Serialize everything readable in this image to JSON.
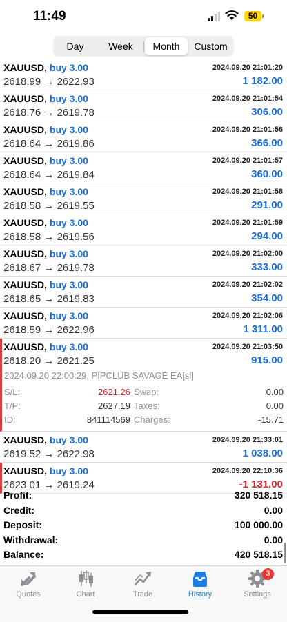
{
  "status_bar": {
    "time": "11:49",
    "battery": "50"
  },
  "period_tabs": [
    {
      "label": "Day",
      "active": false
    },
    {
      "label": "Week",
      "active": false
    },
    {
      "label": "Month",
      "active": true
    },
    {
      "label": "Custom",
      "active": false
    }
  ],
  "deals": [
    {
      "symbol": "XAUUSD,",
      "type": "buy 3.00",
      "time": "2024.09.20 21:01:20",
      "open_price": "2618.99",
      "arrow": "→",
      "close_price": "2622.93",
      "profit": "1 182.00"
    },
    {
      "symbol": "XAUUSD,",
      "type": "buy 3.00",
      "time": "2024.09.20 21:01:54",
      "open_price": "2618.76",
      "arrow": "→",
      "close_price": "2619.78",
      "profit": "306.00"
    },
    {
      "symbol": "XAUUSD,",
      "type": "buy 3.00",
      "time": "2024.09.20 21:01:56",
      "open_price": "2618.64",
      "arrow": "→",
      "close_price": "2619.86",
      "profit": "366.00"
    },
    {
      "symbol": "XAUUSD,",
      "type": "buy 3.00",
      "time": "2024.09.20 21:01:57",
      "open_price": "2618.64",
      "arrow": "→",
      "close_price": "2619.84",
      "profit": "360.00"
    },
    {
      "symbol": "XAUUSD,",
      "type": "buy 3.00",
      "time": "2024.09.20 21:01:58",
      "open_price": "2618.58",
      "arrow": "→",
      "close_price": "2619.55",
      "profit": "291.00"
    },
    {
      "symbol": "XAUUSD,",
      "type": "buy 3.00",
      "time": "2024.09.20 21:01:59",
      "open_price": "2618.58",
      "arrow": "→",
      "close_price": "2619.56",
      "profit": "294.00"
    },
    {
      "symbol": "XAUUSD,",
      "type": "buy 3.00",
      "time": "2024.09.20 21:02:00",
      "open_price": "2618.67",
      "arrow": "→",
      "close_price": "2619.78",
      "profit": "333.00"
    },
    {
      "symbol": "XAUUSD,",
      "type": "buy 3.00",
      "time": "2024.09.20 21:02:02",
      "open_price": "2618.65",
      "arrow": "→",
      "close_price": "2619.83",
      "profit": "354.00"
    },
    {
      "symbol": "XAUUSD,",
      "type": "buy 3.00",
      "time": "2024.09.20 21:02:06",
      "open_price": "2618.59",
      "arrow": "→",
      "close_price": "2622.96",
      "profit": "1 311.00"
    },
    {
      "symbol": "XAUUSD,",
      "type": "buy 3.00",
      "time": "2024.09.20 21:03:50",
      "open_price": "2618.20",
      "arrow": "→",
      "close_price": "2621.25",
      "profit": "915.00"
    },
    {
      "symbol": "XAUUSD,",
      "type": "buy 3.00",
      "time": "2024.09.20 21:33:01",
      "open_price": "2619.52",
      "arrow": "→",
      "close_price": "2622.98",
      "profit": "1 038.00"
    },
    {
      "symbol": "XAUUSD,",
      "type": "buy 3.00",
      "time": "2024.09.20 22:10:36",
      "open_price": "2623.01",
      "arrow": "→",
      "close_price": "2619.24",
      "profit": "-1 131.00"
    }
  ],
  "expanded_details": {
    "comment": "2024.09.20 22:00:29, PIPCLUB SAVAGE EA[sl]",
    "sl_label": "S/L:",
    "sl_value": "2621.26",
    "tp_label": "T/P:",
    "tp_value": "2627.19",
    "id_label": "ID:",
    "id_value": "841114569",
    "swap_label": "Swap:",
    "swap_value": "0.00",
    "taxes_label": "Taxes:",
    "taxes_value": "0.00",
    "charges_label": "Charges:",
    "charges_value": "-15.71"
  },
  "summary": [
    {
      "label": "Profit:",
      "value": "320 518.15"
    },
    {
      "label": "Credit:",
      "value": "0.00"
    },
    {
      "label": "Deposit:",
      "value": "100 000.00"
    },
    {
      "label": "Withdrawal:",
      "value": "0.00"
    },
    {
      "label": "Balance:",
      "value": "420 518.15"
    }
  ],
  "tab_bar": {
    "items": [
      {
        "label": "Quotes",
        "icon": "quotes-icon"
      },
      {
        "label": "Chart",
        "icon": "chart-icon"
      },
      {
        "label": "Trade",
        "icon": "trade-icon"
      },
      {
        "label": "History",
        "icon": "history-icon",
        "active": true
      },
      {
        "label": "Settings",
        "icon": "settings-icon",
        "badge": "3"
      }
    ]
  },
  "colors": {
    "accent": "#1a7ee6",
    "profit_positive": "#1a6ed8",
    "profit_negative": "#d8242c",
    "marker": "#e03c3c"
  }
}
